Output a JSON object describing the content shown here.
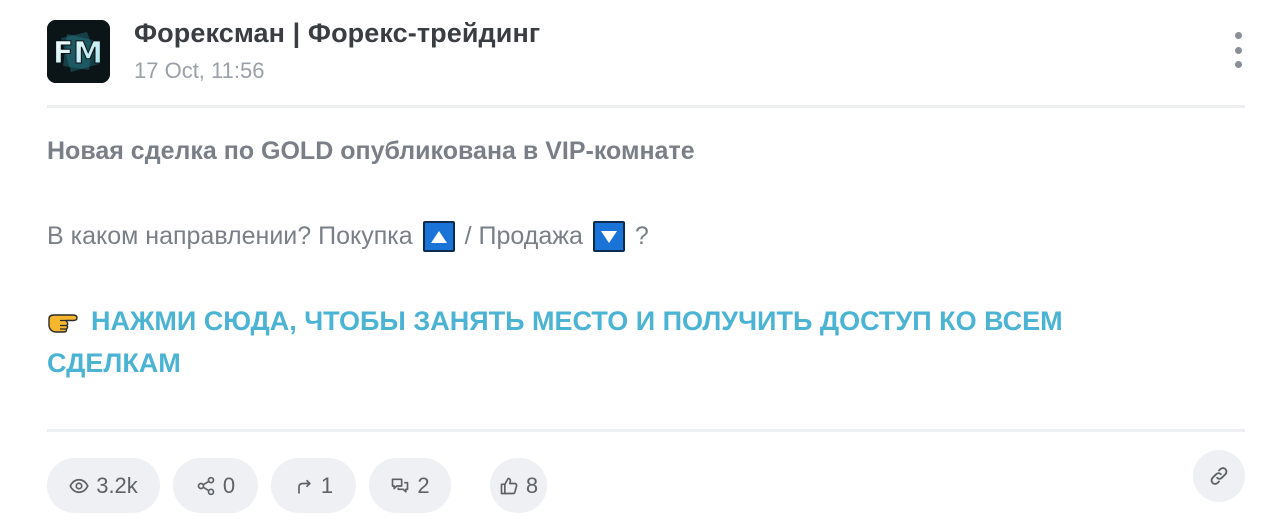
{
  "channel": {
    "name": "Форексман | Форекс-трейдинг",
    "time": "17 Oct, 11:56",
    "avatar_text": "FM"
  },
  "post": {
    "headline": "Новая сделка по GOLD опубликована в VIP-комнате",
    "question_start": "В каком направлении? Покупка",
    "question_mid": "/ Продажа",
    "question_end": "?",
    "cta": "НАЖМИ СЮДА, ЧТОБЫ ЗАНЯТЬ МЕСТО И ПОЛУЧИТЬ ДОСТУП КО ВСЕМ СДЕЛКАМ"
  },
  "stats": {
    "views": "3.2k",
    "shares": "0",
    "forwards": "1",
    "comments": "2",
    "likes": "8"
  },
  "icons": {
    "views": "eye-icon",
    "shares": "share-icon",
    "forwards": "forward-icon",
    "comments": "comments-icon",
    "likes": "thumbs-up-icon",
    "link": "link-icon",
    "menu": "more-vertical-icon"
  },
  "colors": {
    "accent": "#4bb3d3",
    "text": "#7a7f87",
    "title": "#3a3d42",
    "arrow_box": "#1a73d6"
  }
}
